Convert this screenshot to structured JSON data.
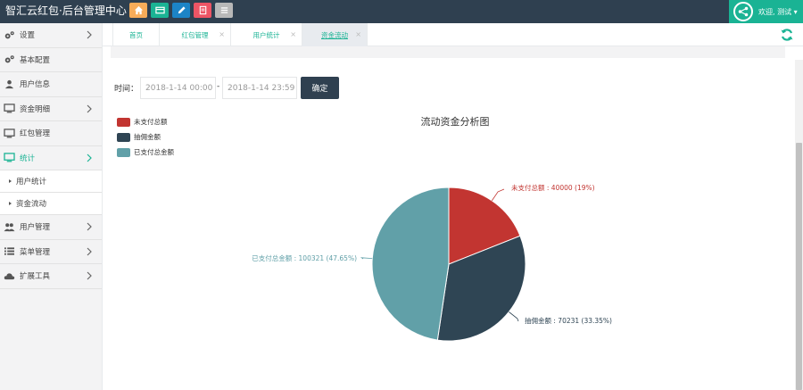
{
  "header": {
    "title": "智汇云红包·后台管理中心",
    "quick_buttons": [
      {
        "icon": "home-icon",
        "color": "#f8ac59"
      },
      {
        "icon": "card-icon",
        "color": "#1ab394"
      },
      {
        "icon": "pencil-icon",
        "color": "#1c84c6"
      },
      {
        "icon": "document-icon",
        "color": "#ed5565"
      },
      {
        "icon": "list-icon",
        "color": "#b8b8b8"
      }
    ],
    "user_label": "欢迎, 测试 ▾"
  },
  "sidebar": {
    "items": [
      {
        "label": "设置",
        "icon": "gears-icon",
        "has_chevron": true
      },
      {
        "label": "基本配置",
        "icon": "gears-icon",
        "has_chevron": false
      },
      {
        "label": "用户信息",
        "icon": "user-icon",
        "has_chevron": false
      },
      {
        "label": "资金明细",
        "icon": "monitor-icon",
        "has_chevron": true
      },
      {
        "label": "红包管理",
        "icon": "monitor-icon",
        "has_chevron": false
      },
      {
        "label": "统计",
        "icon": "monitor-icon",
        "has_chevron": true,
        "active": true
      }
    ],
    "sub_items": [
      {
        "label": "用户统计"
      },
      {
        "label": "资金流动"
      }
    ],
    "items_after": [
      {
        "label": "用户管理",
        "icon": "users-icon",
        "has_chevron": true
      },
      {
        "label": "菜单管理",
        "icon": "list-icon",
        "has_chevron": true
      },
      {
        "label": "扩展工具",
        "icon": "cloud-icon",
        "has_chevron": true
      }
    ]
  },
  "tabs": [
    {
      "label": "首页",
      "closable": false,
      "active": false
    },
    {
      "label": "红包管理",
      "closable": true,
      "active": false
    },
    {
      "label": "用户统计",
      "closable": true,
      "active": false
    },
    {
      "label": "资金流动",
      "closable": true,
      "active": true
    }
  ],
  "filter": {
    "label": "时间：",
    "start": "2018-1-14 00:00",
    "end": "2018-1-14 23:59",
    "separator": "-",
    "confirm": "确定"
  },
  "colors": {
    "accent": "#1ab394",
    "navy": "#2f4050"
  },
  "chart_data": {
    "type": "pie",
    "title": "流动资金分析图",
    "series": [
      {
        "name": "未支付总额",
        "value": 40000,
        "percent": "19%",
        "color": "#c23531",
        "label": "未支付总额 : 40000 (19%)"
      },
      {
        "name": "抽佣金额",
        "value": 70231,
        "percent": "33.35%",
        "color": "#2f4554",
        "label": "抽佣金额 : 70231 (33.35%)"
      },
      {
        "name": "已支付总金额",
        "value": 100321,
        "percent": "47.65%",
        "color": "#61a0a8",
        "label": "已支付总金额 : 100321 (47.65%)"
      }
    ],
    "legend_position": "top-left"
  }
}
